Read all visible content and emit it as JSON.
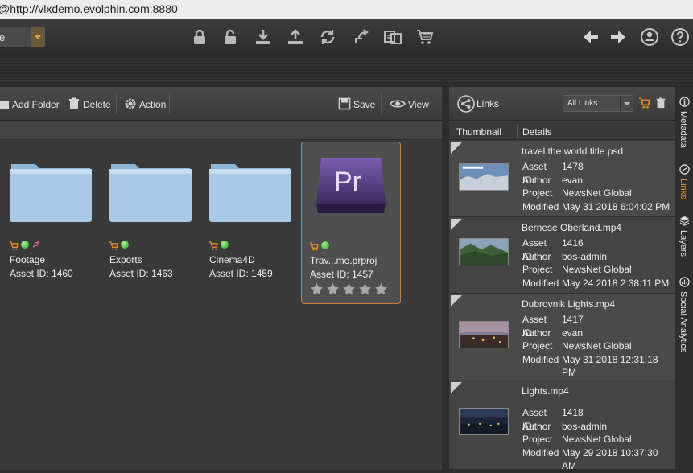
{
  "browser": {
    "url": "@http://vlxdemo.evolphin.com:8880"
  },
  "toolbar": {
    "dropdown_value": "e",
    "icons": [
      "lock-icon",
      "unlock-icon",
      "download-icon",
      "upload-icon",
      "sync-icon",
      "share-icon",
      "duplicate-icon",
      "cart-icon"
    ],
    "right_icons": [
      "back-arrow-icon",
      "forward-arrow-icon",
      "user-icon",
      "help-icon"
    ]
  },
  "left_panel": {
    "actions": {
      "add_folder": "Add Folder",
      "delete": "Delete",
      "action": "Action",
      "save": "Save",
      "view": "View"
    },
    "tiles": [
      {
        "name": "Footage",
        "asset_id": "Asset ID: 1460",
        "type": "folder",
        "badges": [
          "cart",
          "online",
          "link"
        ]
      },
      {
        "name": "Exports",
        "asset_id": "Asset ID: 1463",
        "type": "folder",
        "badges": [
          "cart",
          "online"
        ]
      },
      {
        "name": "Cinema4D",
        "asset_id": "Asset ID: 1459",
        "type": "folder",
        "badges": [
          "cart",
          "online"
        ]
      },
      {
        "name": "Trav...mo.prproj",
        "asset_id": "Asset ID: 1457",
        "type": "premiere",
        "icon_text": "Pr",
        "badges": [
          "cart",
          "online"
        ],
        "rating": 0,
        "selected": true
      }
    ]
  },
  "right_panel": {
    "title": "Links",
    "filter": "All Links",
    "columns": {
      "thumbnail": "Thumbnail",
      "details": "Details"
    },
    "labels": {
      "asset_id": "Asset ID",
      "author": "Author",
      "project": "Project",
      "modified": "Modified"
    },
    "rows": [
      {
        "file": "travel the world title.psd",
        "asset_id": "1478",
        "author": "evan",
        "project": "NewsNet Global",
        "modified": [
          "May 31 2018 6:04:02 PM"
        ]
      },
      {
        "file": "Bernese Oberland.mp4",
        "asset_id": "1416",
        "author": "bos-admin",
        "project": "NewsNet Global",
        "modified": [
          "May 24 2018 2:38:11 PM"
        ]
      },
      {
        "file": "Dubrovnik Lights.mp4",
        "asset_id": "1417",
        "author": "evan",
        "project": "NewsNet Global",
        "modified": [
          "May 31 2018 12:31:18",
          "PM"
        ]
      },
      {
        "file": "Lights.mp4",
        "asset_id": "1418",
        "author": "bos-admin",
        "project": "NewsNet Global",
        "modified": [
          "May 29 2018 10:37:30",
          "AM"
        ]
      }
    ]
  },
  "side_tabs": [
    {
      "label": "Metadata",
      "active": false
    },
    {
      "label": "Links",
      "active": true
    },
    {
      "label": "Layers",
      "active": false
    },
    {
      "label": "Social Analytics",
      "active": false
    }
  ],
  "colors": {
    "accent": "#e0a040",
    "selected_border": "#c8823a",
    "status_online": "#2fa42a"
  }
}
